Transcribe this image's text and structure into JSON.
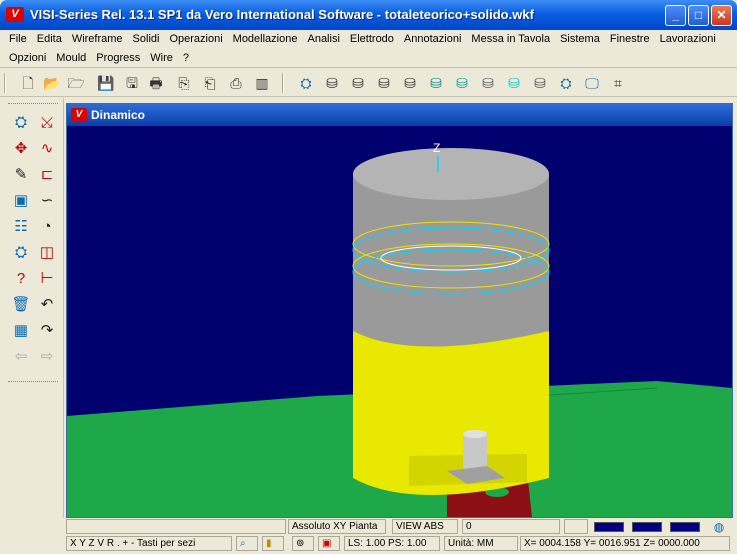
{
  "window": {
    "title": "VISI-Series Rel. 13.1 SP1 da Vero International Software - totaleteorico+solido.wkf",
    "logo_letter": "V",
    "minimize_glyph": "_",
    "maximize_glyph": "□",
    "close_glyph": "✕"
  },
  "menu": {
    "row1": [
      "File",
      "Edita",
      "Wireframe",
      "Solidi",
      "Operazioni",
      "Modellazione",
      "Analisi",
      "Elettrodo",
      "Annotazioni",
      "Messa in Tavola",
      "Sistema",
      "Finestre",
      "Lavorazioni"
    ],
    "row2": [
      "Opzioni",
      "Mould",
      "Progress",
      "Wire",
      "?"
    ]
  },
  "toolbar": {
    "icons": [
      "new-file-icon",
      "open-folder-icon",
      "open-archive-icon",
      "save-icon",
      "save-all-icon",
      "print-icon",
      "import-icon",
      "export-icon",
      "plot-icon",
      "layout-icon",
      "render-icon",
      "cylinder-icon",
      "cylinder-icon",
      "cylinder-icon",
      "cylinder-icon",
      "cylinder-icon",
      "cylinder-icon",
      "cylinder-icon",
      "cylinder-icon",
      "cylinder-icon",
      "cylinder-icon",
      "cylinder-icon",
      "cylinder-icon"
    ]
  },
  "viewport": {
    "title": "Dinamico",
    "axis_label": "Z",
    "background": "#00006f",
    "ground": "#1fa84a",
    "cylinder_top": "#a0a0a0",
    "cylinder_bottom": "#e8e800",
    "base_block": "#8b0f14"
  },
  "status": {
    "axis_hint": "X Y Z V R . + - Tasti per sezi",
    "view_mode": "Assoluto XY Pianta",
    "view_abs": "VIEW ABS",
    "value": "0",
    "ls_ps": "LS: 1.00 PS: 1.00",
    "units": "Unità: MM",
    "coords": "X= 0004.158 Y= 0016.951 Z= 0000.000"
  }
}
